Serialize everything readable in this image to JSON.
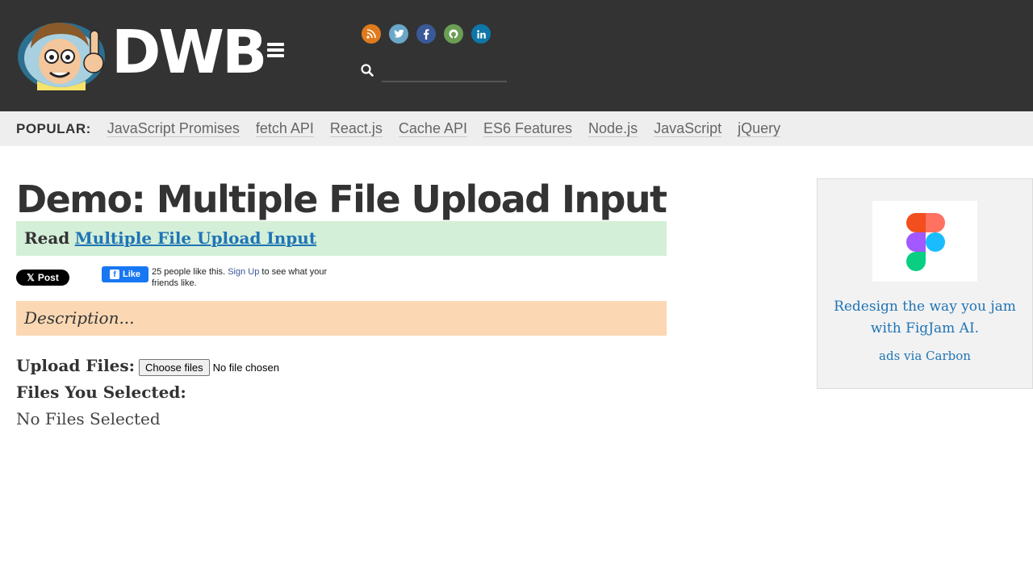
{
  "header": {
    "brand": "DWB",
    "social_icons": [
      "rss-icon",
      "twitter-icon",
      "facebook-icon",
      "github-icon",
      "linkedin-icon"
    ],
    "search": {
      "placeholder": "",
      "value": ""
    },
    "colors": {
      "background": "#333333",
      "rss": "#e07b1d",
      "twitter": "#6aa7c8",
      "facebook": "#3b5998",
      "github": "#6a9f55",
      "linkedin": "#0e76a8"
    }
  },
  "popular": {
    "label": "POPULAR:",
    "links": [
      "JavaScript Promises",
      "fetch API",
      "React.js",
      "Cache API",
      "ES6 Features",
      "Node.js",
      "JavaScript",
      "jQuery"
    ]
  },
  "main": {
    "title": "Demo: Multiple File Upload Input",
    "read": {
      "prefix": "Read",
      "link_text": "Multiple File Upload Input"
    },
    "share": {
      "x_post_label": "Post",
      "fb_like_label": "Like",
      "fb_text_count": "25 people like this.",
      "fb_text_signup": "Sign Up",
      "fb_text_suffix": "to see what your friends like."
    },
    "description": "Description...",
    "upload": {
      "label": "Upload Files:",
      "button_label": "Choose files",
      "status": "No file chosen"
    },
    "selected": {
      "label": "Files You Selected:",
      "value": "No Files Selected"
    }
  },
  "ad": {
    "text": "Redesign the way you jam with FigJam AI.",
    "via": "ads via Carbon",
    "image_icon": "figma-logo-icon"
  }
}
